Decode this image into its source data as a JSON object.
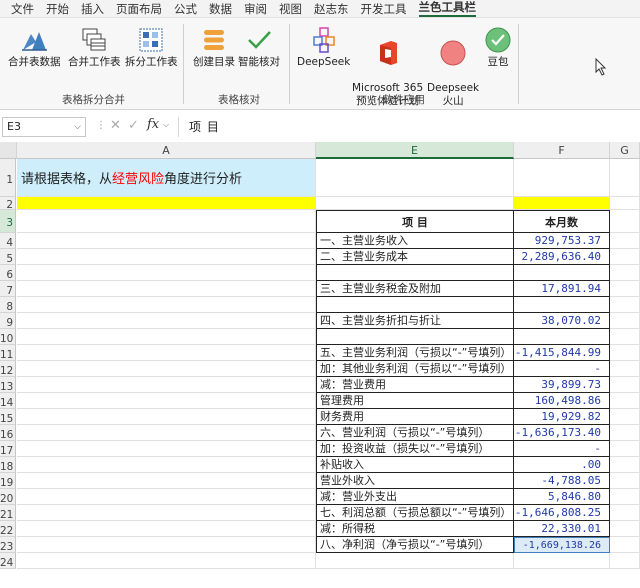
{
  "menubar": {
    "items": [
      "文件",
      "开始",
      "插入",
      "页面布局",
      "公式",
      "数据",
      "审阅",
      "视图",
      "赵志东",
      "开发工具",
      "兰色工具栏"
    ],
    "active_index": 10
  },
  "ribbon": {
    "groups": [
      {
        "label": "表格拆分合并",
        "buttons": [
          "合并表数据",
          "合并工作表",
          "拆分工作表"
        ]
      },
      {
        "label": "表格核对",
        "buttons": [
          "创建目录",
          "智能核对"
        ]
      },
      {
        "label": "软件应用",
        "buttons": [
          "DeepSeek",
          "Microsoft 365\n预览体验计划",
          "Deepseek\n火山",
          "豆包"
        ]
      }
    ]
  },
  "formula_bar": {
    "name_box": "E3",
    "fx": "fx",
    "content": "项    目"
  },
  "columns": [
    "A",
    "E",
    "F",
    "G"
  ],
  "rows": [
    "1",
    "2",
    "3",
    "4",
    "5",
    "6",
    "7",
    "8",
    "9",
    "10",
    "11",
    "12",
    "13",
    "14",
    "15",
    "16",
    "17",
    "18",
    "19",
    "20",
    "21",
    "22",
    "23",
    "24"
  ],
  "prompt": {
    "part1": "请根据表格，从",
    "highlight": "经营风险",
    "part2": "角度进行分析"
  },
  "table": {
    "headers": [
      "项        目",
      "本月数"
    ],
    "rows": [
      {
        "label": "一、主营业务收入",
        "value": "929,753.37"
      },
      {
        "label": "二、主营业务成本",
        "value": "2,289,636.40"
      },
      {
        "label": "",
        "value": ""
      },
      {
        "label": "  三、主营业务税金及附加",
        "value": "17,891.94"
      },
      {
        "label": "",
        "value": ""
      },
      {
        "label": "四、主营业务折扣与折让",
        "value": "38,070.02"
      },
      {
        "label": "",
        "value": ""
      },
      {
        "label": "五、主营业务利润（亏损以“-”号填列）",
        "value": "-1,415,844.99"
      },
      {
        "label": "   加：其他业务利润（亏损以“-”号填列）",
        "value": "-"
      },
      {
        "label": "   减：营业费用",
        "value": "39,899.73"
      },
      {
        "label": "           管理费用",
        "value": "160,498.86"
      },
      {
        "label": "           财务费用",
        "value": "19,929.82"
      },
      {
        "label": "六、营业利润（亏损以“-”号填列）",
        "value": "-1,636,173.40"
      },
      {
        "label": "   加：投资收益（损失以“-”号填列）",
        "value": "-"
      },
      {
        "label": "        补贴收入",
        "value": ".00"
      },
      {
        "label": "        营业外收入",
        "value": "-4,788.05"
      },
      {
        "label": "   减：营业外支出",
        "value": "5,846.80"
      },
      {
        "label": "七、利润总额（亏损总额以“-”号填列）",
        "value": "-1,646,808.25"
      },
      {
        "label": "   减：所得税",
        "value": "22,330.01"
      },
      {
        "label": "八、净利润（净亏损以“-”号填列）",
        "value": "-1,669,138.26"
      }
    ]
  },
  "colors": {
    "prompt_bg": "#cdeefa",
    "yellow_fill": "#ffff00",
    "highlight_text": "#ff0000",
    "net_profit_bg": "#ddebf7",
    "accent": "#1e6b3a"
  }
}
